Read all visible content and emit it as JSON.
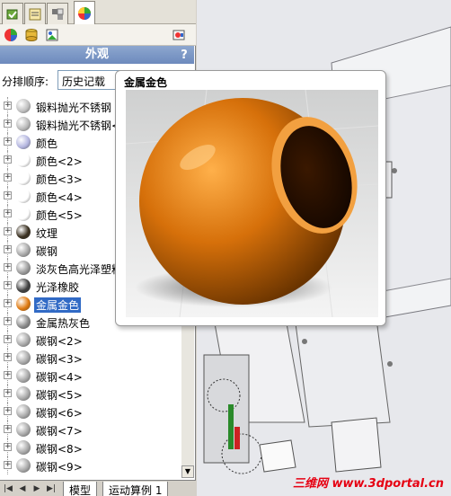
{
  "panel": {
    "title": "外观",
    "help_label": "?",
    "sort_label": "分排顺序:",
    "sort_value": "历史记载"
  },
  "tabs": [
    "feature-manager",
    "property-manager",
    "configuration-manager",
    "display-manager"
  ],
  "tree_items": [
    {
      "label": "锻料抛光不锈钢",
      "color": "#c0c0c0"
    },
    {
      "label": "锻料抛光不锈钢<",
      "color": "#b8b8b8"
    },
    {
      "label": "颜色",
      "color": "#b4b6e0"
    },
    {
      "label": "颜色<2>",
      "color": "#ffffff"
    },
    {
      "label": "颜色<3>",
      "color": "#ffffff"
    },
    {
      "label": "颜色<4>",
      "color": "#ffffff"
    },
    {
      "label": "颜色<5>",
      "color": "#ffffff"
    },
    {
      "label": "纹理",
      "color": "#3a3020"
    },
    {
      "label": "碳钢",
      "color": "#a8a8a8"
    },
    {
      "label": "淡灰色高光泽塑料",
      "color": "#9a9a9a"
    },
    {
      "label": "光泽橡胶",
      "color": "#404040"
    },
    {
      "label": "金属金色",
      "color": "#e07a10"
    },
    {
      "label": "金属热灰色",
      "color": "#8a8a8a"
    },
    {
      "label": "碳钢<2>",
      "color": "#a8a8a8"
    },
    {
      "label": "碳钢<3>",
      "color": "#a8a8a8"
    },
    {
      "label": "碳钢<4>",
      "color": "#a8a8a8"
    },
    {
      "label": "碳钢<5>",
      "color": "#a8a8a8"
    },
    {
      "label": "碳钢<6>",
      "color": "#a8a8a8"
    },
    {
      "label": "碳钢<7>",
      "color": "#a8a8a8"
    },
    {
      "label": "碳钢<8>",
      "color": "#a8a8a8"
    },
    {
      "label": "碳钢<9>",
      "color": "#a8a8a8"
    }
  ],
  "selected_item": "金属金色",
  "bottom_tabs": {
    "model": "模型",
    "motion": "运动算例 1"
  },
  "popup": {
    "title": "金属金色"
  },
  "watermark": "三维网 www.3dportal.cn",
  "colors": {
    "accent": "#316ac5",
    "gold": "#e07a10",
    "watermark": "#e60012"
  }
}
